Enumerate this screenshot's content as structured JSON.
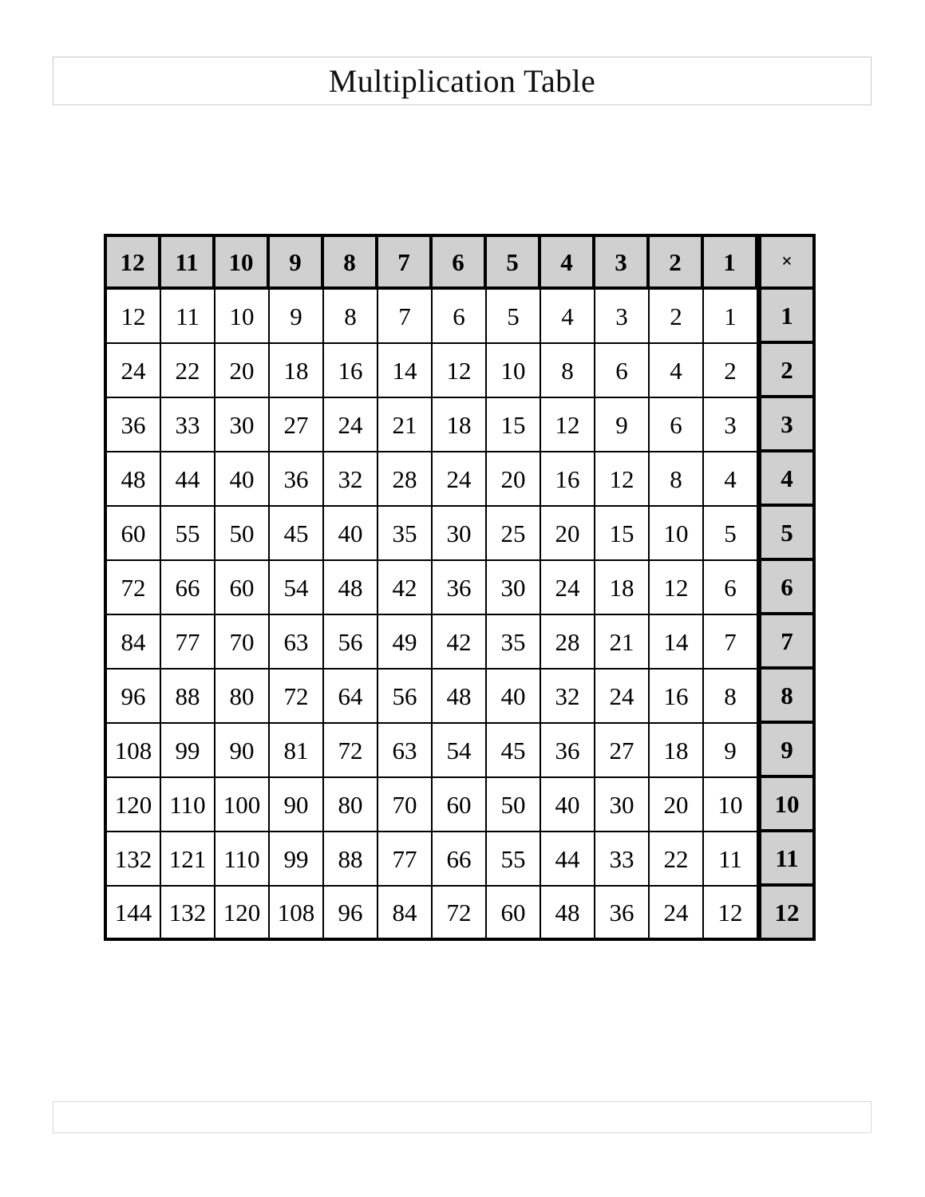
{
  "page": {
    "title": "Multiplication Table",
    "footer_note": ""
  },
  "chart_data": {
    "type": "table",
    "title": "Multiplication Table",
    "operator_symbol": "×",
    "column_headers": [
      12,
      11,
      10,
      9,
      8,
      7,
      6,
      5,
      4,
      3,
      2,
      1
    ],
    "row_headers": [
      1,
      2,
      3,
      4,
      5,
      6,
      7,
      8,
      9,
      10,
      11,
      12
    ],
    "column_order": "descending",
    "row_order": "ascending",
    "header_fill_color": "#d0d0d0",
    "grid_line_color": "#000000",
    "cell_fill_color": "#ffffff",
    "rows": [
      {
        "header": 1,
        "values": [
          12,
          11,
          10,
          9,
          8,
          7,
          6,
          5,
          4,
          3,
          2,
          1
        ]
      },
      {
        "header": 2,
        "values": [
          24,
          22,
          20,
          18,
          16,
          14,
          12,
          10,
          8,
          6,
          4,
          2
        ]
      },
      {
        "header": 3,
        "values": [
          36,
          33,
          30,
          27,
          24,
          21,
          18,
          15,
          12,
          9,
          6,
          3
        ]
      },
      {
        "header": 4,
        "values": [
          48,
          44,
          40,
          36,
          32,
          28,
          24,
          20,
          16,
          12,
          8,
          4
        ]
      },
      {
        "header": 5,
        "values": [
          60,
          55,
          50,
          45,
          40,
          35,
          30,
          25,
          20,
          15,
          10,
          5
        ]
      },
      {
        "header": 6,
        "values": [
          72,
          66,
          60,
          54,
          48,
          42,
          36,
          30,
          24,
          18,
          12,
          6
        ]
      },
      {
        "header": 7,
        "values": [
          84,
          77,
          70,
          63,
          56,
          49,
          42,
          35,
          28,
          21,
          14,
          7
        ]
      },
      {
        "header": 8,
        "values": [
          96,
          88,
          80,
          72,
          64,
          56,
          48,
          40,
          32,
          24,
          16,
          8
        ]
      },
      {
        "header": 9,
        "values": [
          108,
          99,
          90,
          81,
          72,
          63,
          54,
          45,
          36,
          27,
          18,
          9
        ]
      },
      {
        "header": 10,
        "values": [
          120,
          110,
          100,
          90,
          80,
          70,
          60,
          50,
          40,
          30,
          20,
          10
        ]
      },
      {
        "header": 11,
        "values": [
          132,
          121,
          110,
          99,
          88,
          77,
          66,
          55,
          44,
          33,
          22,
          11
        ]
      },
      {
        "header": 12,
        "values": [
          144,
          132,
          120,
          108,
          96,
          84,
          72,
          60,
          48,
          36,
          24,
          12
        ]
      }
    ]
  }
}
